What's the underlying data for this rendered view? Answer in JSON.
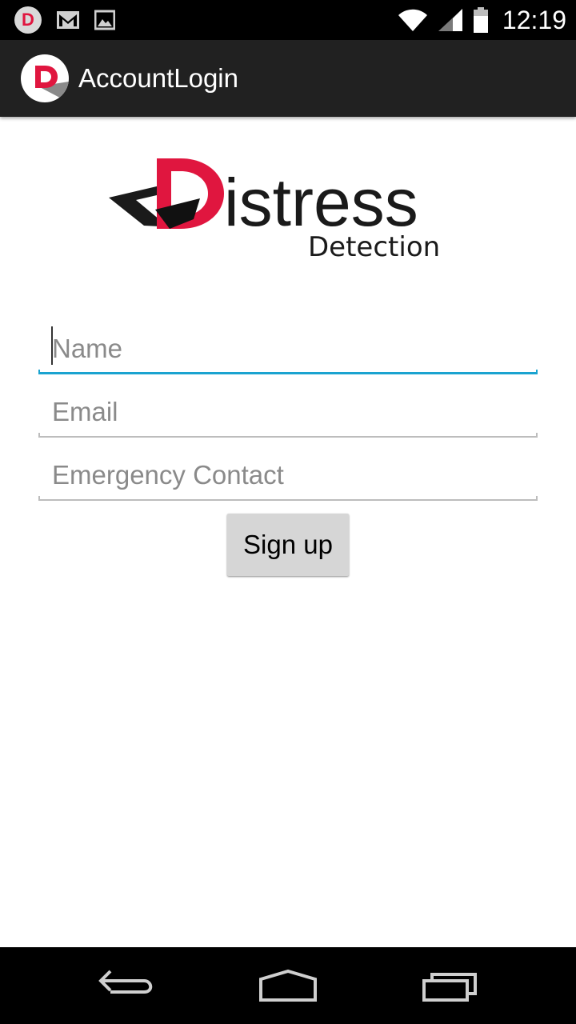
{
  "status_bar": {
    "time": "12:19",
    "notification_icons": [
      "distress-app-icon",
      "gmail-icon",
      "image-icon"
    ],
    "system_icons": [
      "wifi-icon",
      "signal-icon",
      "battery-icon"
    ]
  },
  "action_bar": {
    "title": "AccountLogin",
    "logo_letter": "D"
  },
  "brand": {
    "name_rest": "istress",
    "name_initial": "D",
    "subtitle": "Detection",
    "accent_color": "#e0163f"
  },
  "form": {
    "name_placeholder": "Name",
    "email_placeholder": "Email",
    "emergency_placeholder": "Emergency Contact",
    "signup_label": "Sign up",
    "focus_color": "#1aa3d0"
  },
  "nav_bar": {
    "buttons": [
      "back-icon",
      "home-icon",
      "recent-apps-icon"
    ]
  }
}
